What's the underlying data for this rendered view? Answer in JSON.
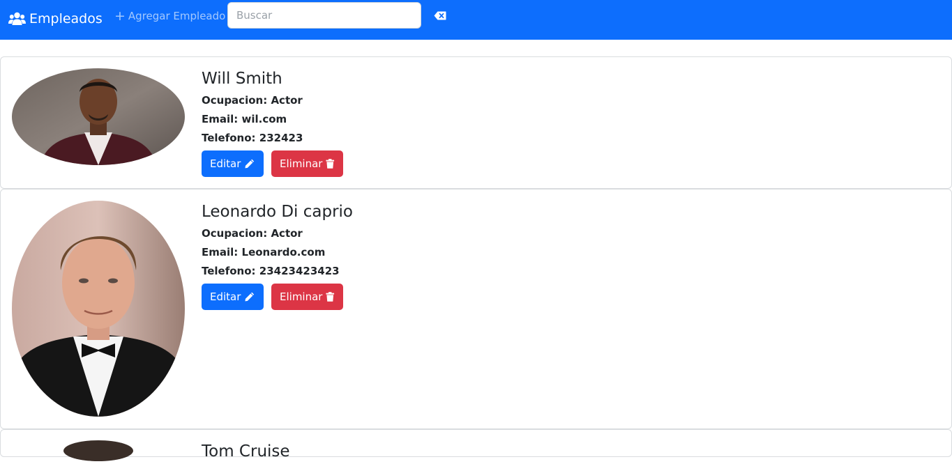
{
  "navbar": {
    "brand": "Empleados",
    "add_label": "Agregar Empleado",
    "search_placeholder": "Buscar",
    "search_value": ""
  },
  "labels": {
    "occupation": "Ocupacion:",
    "email": "Email:",
    "phone": "Telefono:",
    "edit": "Editar",
    "delete": "Eliminar"
  },
  "employees": [
    {
      "name": "Will Smith",
      "occupation": "Actor",
      "email": "wil.com",
      "phone": "232423"
    },
    {
      "name": "Leonardo Di caprio",
      "occupation": "Actor",
      "email": "Leonardo.com",
      "phone": "23423423423"
    },
    {
      "name": "Tom Cruise"
    }
  ],
  "colors": {
    "primary": "#0d6efd",
    "danger": "#dc3545"
  }
}
